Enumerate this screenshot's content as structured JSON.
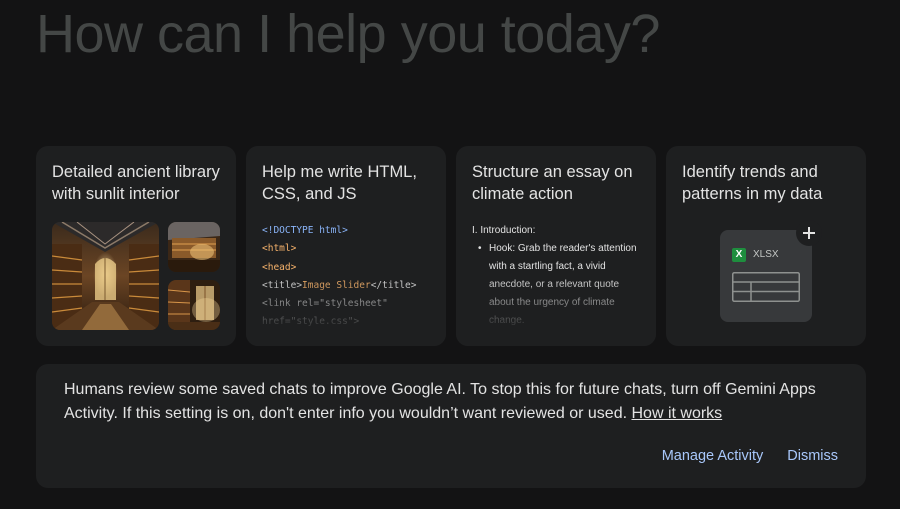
{
  "greeting": "How can I help you today?",
  "cards": [
    {
      "title": "Detailed ancient library with sunlit interior"
    },
    {
      "title": "Help me write HTML, CSS, and JS",
      "code_lines": [
        {
          "parts": [
            {
              "text": "<!DOCTYPE html>",
              "color": "#8ab4f8"
            }
          ]
        },
        {
          "parts": [
            {
              "text": "<html>",
              "color": "#f6b26b"
            }
          ]
        },
        {
          "parts": [
            {
              "text": "<head>",
              "color": "#f6b26b"
            }
          ]
        },
        {
          "parts": [
            {
              "text": "<title>",
              "color": "#e3e3e3"
            },
            {
              "text": "Image Slider",
              "color": "#f6b26b"
            },
            {
              "text": "</title>",
              "color": "#e3e3e3"
            }
          ]
        },
        {
          "parts": [
            {
              "text": "<link rel=\"stylesheet\"",
              "color": "#e3e3e3"
            }
          ]
        },
        {
          "parts": [
            {
              "text": "href=\"style.css\">",
              "color": "#e3e3e3"
            }
          ]
        }
      ]
    },
    {
      "title": "Structure an essay on climate action",
      "essay_heading": "I. Introduction:",
      "essay_bullet": "Hook: Grab the reader's attention with a startling fact, a vivid anecdote, or a relevant quote about the urgency of climate change."
    },
    {
      "title": "Identify trends and patterns in my data",
      "file_badge": "X",
      "file_label": "XLSX"
    }
  ],
  "notice": {
    "text": "Humans review some saved chats to improve Google AI. To stop this for future chats, turn off Gemini Apps Activity. If this setting is on, don't enter info you wouldn’t want reviewed or used.",
    "link": "How it works",
    "manage_label": "Manage Activity",
    "dismiss_label": "Dismiss"
  },
  "colors": {
    "background": "#131314",
    "card": "#1e1f20",
    "accent": "#a8c7fa",
    "greeting": "#444746",
    "xlsx_green": "#1e8e3e"
  },
  "icons": {
    "add": "plus-icon",
    "spreadsheet": "spreadsheet-icon"
  }
}
